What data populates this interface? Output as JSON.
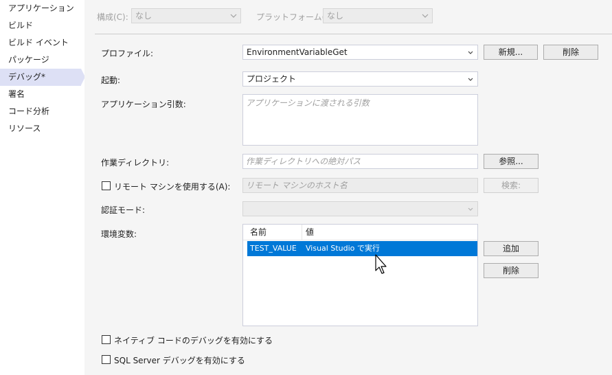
{
  "sidebar": {
    "items": [
      {
        "label": "アプリケーション",
        "active": false
      },
      {
        "label": "ビルド",
        "active": false
      },
      {
        "label": "ビルド イベント",
        "active": false
      },
      {
        "label": "パッケージ",
        "active": false
      },
      {
        "label": "デバッグ*",
        "active": true
      },
      {
        "label": "署名",
        "active": false
      },
      {
        "label": "コード分析",
        "active": false
      },
      {
        "label": "リソース",
        "active": false
      }
    ]
  },
  "topbar": {
    "config_label": "構成(C):",
    "config_value": "なし",
    "platform_label": "プラットフォーム(M):",
    "platform_value": "なし"
  },
  "profile": {
    "label": "プロファイル:",
    "value": "EnvironmentVariableGet",
    "new_button": "新規...",
    "delete_button": "削除"
  },
  "launch": {
    "label": "起動:",
    "value": "プロジェクト"
  },
  "app_args": {
    "label": "アプリケーション引数:",
    "placeholder": "アプリケーションに渡される引数"
  },
  "workdir": {
    "label": "作業ディレクトリ:",
    "placeholder": "作業ディレクトリへの絶対パス",
    "browse_button": "参照..."
  },
  "remote": {
    "label": "リモート マシンを使用する(A):",
    "checked": false,
    "placeholder": "リモート マシンのホスト名",
    "search_button": "検索:"
  },
  "auth": {
    "label": "認証モード:",
    "value": ""
  },
  "env": {
    "label": "環境変数:",
    "columns": [
      "名前",
      "値"
    ],
    "rows": [
      {
        "name": "TEST_VALUE",
        "value": "Visual Studio で実行",
        "selected": true
      }
    ],
    "add_button": "追加",
    "delete_button": "削除"
  },
  "native_debug": {
    "label": "ネイティブ コードのデバッグを有効にする",
    "checked": false
  },
  "sql_debug": {
    "label": "SQL Server デバッグを有効にする",
    "checked": false
  },
  "colors": {
    "selection": "#0078d7",
    "active_nav": "#dde0f5",
    "panel_bg": "#f5f5f5"
  }
}
